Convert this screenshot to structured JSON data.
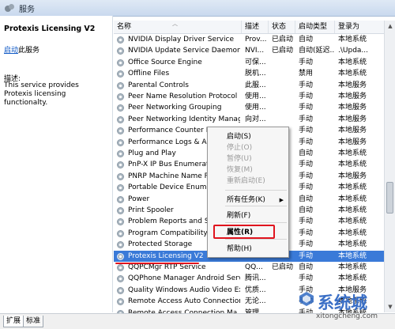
{
  "window": {
    "title": "服务"
  },
  "left_panel": {
    "service_name": "Protexis Licensing V2",
    "start_link": "启动",
    "start_suffix": "此服务",
    "description_label": "描述:",
    "description": "This service provides Protexis licensing functionalty."
  },
  "columns": [
    "名称",
    "描述",
    "状态",
    "启动类型",
    "登录为"
  ],
  "rows": [
    [
      "NVIDIA Display Driver Service",
      "Prov...",
      "已启动",
      "自动",
      "本地系统"
    ],
    [
      "NVIDIA Update Service Daemon",
      "NVI...",
      "已启动",
      "自动(延迟...",
      ".\\Upda..."
    ],
    [
      "Office Source Engine",
      "可保...",
      "",
      "手动",
      "本地系统"
    ],
    [
      "Offline Files",
      "脱机...",
      "",
      "禁用",
      "本地系统"
    ],
    [
      "Parental Controls",
      "此服...",
      "",
      "手动",
      "本地服务"
    ],
    [
      "Peer Name Resolution Protocol",
      "使用...",
      "",
      "手动",
      "本地服务"
    ],
    [
      "Peer Networking Grouping",
      "使用...",
      "",
      "手动",
      "本地服务"
    ],
    [
      "Peer Networking Identity Manager",
      "向对...",
      "",
      "手动",
      "本地服务"
    ],
    [
      "Performance Counter DL",
      "",
      "",
      "手动",
      "本地服务"
    ],
    [
      "Performance Logs & Aler",
      "",
      "",
      "手动",
      "本地服务"
    ],
    [
      "Plug and Play",
      "",
      "",
      "自动",
      "本地系统"
    ],
    [
      "PnP-X IP Bus Enumerator",
      "",
      "",
      "手动",
      "本地系统"
    ],
    [
      "PNRP Machine Name Pub",
      "",
      "",
      "手动",
      "本地服务"
    ],
    [
      "Portable Device Enumera",
      "",
      "",
      "手动",
      "本地系统"
    ],
    [
      "Power",
      "",
      "",
      "自动",
      "本地系统"
    ],
    [
      "Print Spooler",
      "",
      "",
      "自动",
      "本地系统"
    ],
    [
      "Problem Reports and So",
      "",
      "",
      "手动",
      "本地系统"
    ],
    [
      "Program Compatibility A",
      "",
      "",
      "手动",
      "本地系统"
    ],
    [
      "Protected Storage",
      "",
      "",
      "手动",
      "本地系统"
    ],
    [
      "Protexis Licensing V2",
      "This ...",
      "",
      "手动",
      "本地系统"
    ],
    [
      "QQPCMgr RTP Service",
      "QQ...",
      "已启动",
      "自动",
      "本地系统"
    ],
    [
      "QQPhone Manager Android Service",
      "腾讯...",
      "",
      "手动",
      "本地系统"
    ],
    [
      "Quality Windows Audio Video Experie...",
      "优质...",
      "",
      "手动",
      "本地服务"
    ],
    [
      "Remote Access Auto Connection ...",
      "无论...",
      "",
      "手动",
      "本地系统"
    ],
    [
      "Remote Access Connection Ma...",
      "管理...",
      "",
      "手动",
      "本地系统"
    ]
  ],
  "selected_row": 19,
  "context_menu": {
    "items": [
      "启动(S)",
      "停止(O)",
      "暂停(U)",
      "恢复(M)",
      "重新启动(E)",
      "所有任务(K)",
      "刷新(F)",
      "属性(R)",
      "帮助(H)"
    ],
    "disabled": [
      1,
      2,
      3,
      4
    ]
  },
  "tabs": [
    "扩展",
    "标准"
  ],
  "watermark": {
    "text": "系统城",
    "url": "xitongcheng.com"
  },
  "colors": {
    "selection": "#3a7ad8",
    "annotation_red": "#e0141e",
    "link": "#0b56c4"
  }
}
